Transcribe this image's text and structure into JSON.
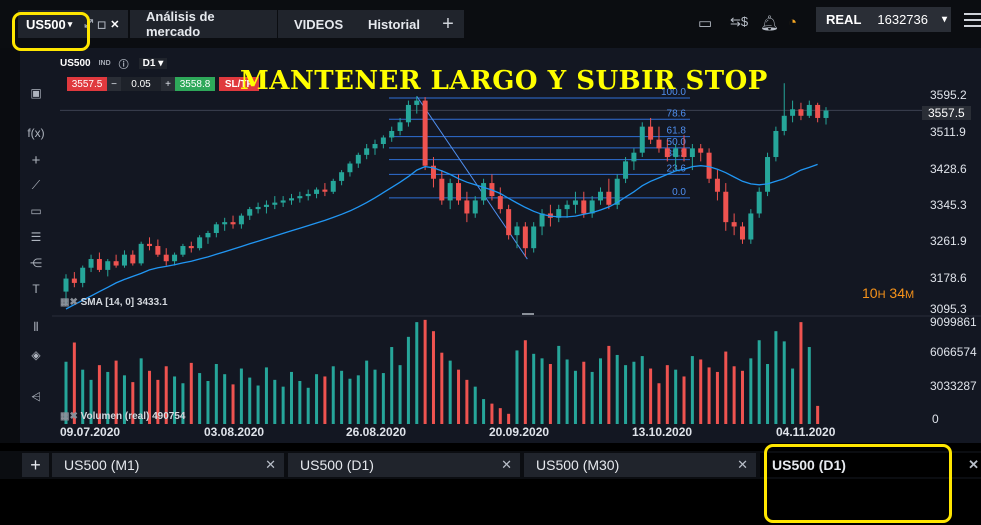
{
  "header": {
    "active_tab": {
      "symbol": "US500",
      "caret": "▾",
      "icons": [
        "expand-icon",
        "window-icon"
      ],
      "close": "✕"
    },
    "tabs": [
      {
        "label": "Análisis de mercado"
      },
      {
        "label": "VIDEOS"
      },
      {
        "label": "Historial"
      }
    ],
    "plus": "+",
    "account": {
      "label": "REAL",
      "balance": "1632736",
      "caret": "▾"
    },
    "icons": [
      "layout-icon",
      "money-icon",
      "bell-icon",
      "wifi-icon",
      "menu-icon"
    ]
  },
  "instrument": {
    "symbol": "US500",
    "type": "IND",
    "info": "ⓘ",
    "timeframe": "D1",
    "caret": "▾",
    "sell": "3557.5",
    "minus": "−",
    "volume": "0.05",
    "plus": "+",
    "buy": "3558.8",
    "sltp": "SL/TP"
  },
  "annotation": "MANTENER LARGO Y SUBIR STOP",
  "price_axis": [
    "3595.2",
    "3557.5",
    "3511.9",
    "3428.6",
    "3345.3",
    "3261.9",
    "3178.6",
    "3095.3"
  ],
  "volume_axis": [
    "9099861",
    "6066574",
    "3033287",
    "0"
  ],
  "timer": {
    "h": "10",
    "hu": "H",
    "m": "34",
    "mu": "M"
  },
  "date_labels": [
    "09.07.2020",
    "03.08.2020",
    "26.08.2020",
    "20.09.2020",
    "13.10.2020",
    "04.11.2020"
  ],
  "sma_legend": "SMA [14, 0] 3433.1",
  "volume_legend": "Volumen (real) 490754",
  "fib_levels": [
    "100.0",
    "78.6",
    "61.8",
    "50.0",
    "38.2",
    "23.6",
    "0.0"
  ],
  "bottom_tabs": [
    {
      "label": "US500 (M1)",
      "close": "✕"
    },
    {
      "label": "US500 (D1)",
      "close": "✕"
    },
    {
      "label": "US500 (M30)",
      "close": "✕"
    },
    {
      "label": "US500 (D1)",
      "close": "✕"
    }
  ],
  "bottom_plus": "+",
  "colors": {
    "up": "#26a69a",
    "down": "#ef5350",
    "sma": "#2196f3",
    "fib": "#2f6fd6",
    "highlight": "#ffe600",
    "annotation": "#ffff00"
  },
  "chart_data": {
    "type": "candlestick",
    "timeframe": "D1",
    "ylim": [
      3095.3,
      3640
    ],
    "candles": [
      [
        3140,
        3180,
        3110,
        3170
      ],
      [
        3170,
        3185,
        3150,
        3160
      ],
      [
        3160,
        3200,
        3150,
        3195
      ],
      [
        3195,
        3225,
        3185,
        3215
      ],
      [
        3215,
        3230,
        3185,
        3190
      ],
      [
        3190,
        3215,
        3175,
        3210
      ],
      [
        3210,
        3225,
        3195,
        3200
      ],
      [
        3200,
        3235,
        3195,
        3225
      ],
      [
        3225,
        3235,
        3200,
        3205
      ],
      [
        3205,
        3255,
        3200,
        3250
      ],
      [
        3250,
        3265,
        3235,
        3245
      ],
      [
        3245,
        3260,
        3220,
        3225
      ],
      [
        3225,
        3240,
        3200,
        3210
      ],
      [
        3210,
        3230,
        3200,
        3225
      ],
      [
        3225,
        3250,
        3220,
        3245
      ],
      [
        3245,
        3255,
        3230,
        3240
      ],
      [
        3240,
        3270,
        3235,
        3265
      ],
      [
        3265,
        3280,
        3250,
        3275
      ],
      [
        3275,
        3300,
        3265,
        3295
      ],
      [
        3295,
        3310,
        3280,
        3300
      ],
      [
        3300,
        3315,
        3285,
        3295
      ],
      [
        3295,
        3320,
        3285,
        3315
      ],
      [
        3315,
        3335,
        3305,
        3330
      ],
      [
        3330,
        3345,
        3320,
        3335
      ],
      [
        3335,
        3350,
        3320,
        3340
      ],
      [
        3340,
        3360,
        3330,
        3345
      ],
      [
        3345,
        3360,
        3335,
        3350
      ],
      [
        3350,
        3365,
        3340,
        3355
      ],
      [
        3355,
        3370,
        3345,
        3360
      ],
      [
        3360,
        3375,
        3350,
        3365
      ],
      [
        3365,
        3380,
        3355,
        3375
      ],
      [
        3375,
        3390,
        3360,
        3370
      ],
      [
        3370,
        3400,
        3365,
        3395
      ],
      [
        3395,
        3420,
        3385,
        3415
      ],
      [
        3415,
        3440,
        3405,
        3435
      ],
      [
        3435,
        3460,
        3425,
        3455
      ],
      [
        3455,
        3480,
        3445,
        3470
      ],
      [
        3470,
        3490,
        3455,
        3480
      ],
      [
        3480,
        3500,
        3470,
        3495
      ],
      [
        3495,
        3520,
        3485,
        3510
      ],
      [
        3510,
        3540,
        3500,
        3530
      ],
      [
        3530,
        3580,
        3520,
        3570
      ],
      [
        3570,
        3590,
        3550,
        3580
      ],
      [
        3580,
        3588,
        3420,
        3430
      ],
      [
        3430,
        3450,
        3380,
        3400
      ],
      [
        3400,
        3420,
        3340,
        3350
      ],
      [
        3350,
        3400,
        3330,
        3390
      ],
      [
        3390,
        3410,
        3340,
        3350
      ],
      [
        3350,
        3370,
        3300,
        3320
      ],
      [
        3320,
        3360,
        3310,
        3350
      ],
      [
        3350,
        3400,
        3340,
        3390
      ],
      [
        3390,
        3410,
        3350,
        3360
      ],
      [
        3360,
        3380,
        3320,
        3330
      ],
      [
        3330,
        3340,
        3260,
        3270
      ],
      [
        3270,
        3300,
        3240,
        3290
      ],
      [
        3290,
        3300,
        3220,
        3240
      ],
      [
        3240,
        3300,
        3230,
        3290
      ],
      [
        3290,
        3330,
        3270,
        3320
      ],
      [
        3320,
        3340,
        3290,
        3310
      ],
      [
        3310,
        3340,
        3300,
        3330
      ],
      [
        3330,
        3350,
        3310,
        3340
      ],
      [
        3340,
        3370,
        3320,
        3350
      ],
      [
        3350,
        3370,
        3310,
        3320
      ],
      [
        3320,
        3360,
        3310,
        3350
      ],
      [
        3350,
        3380,
        3340,
        3370
      ],
      [
        3370,
        3400,
        3330,
        3340
      ],
      [
        3340,
        3410,
        3330,
        3400
      ],
      [
        3400,
        3450,
        3390,
        3440
      ],
      [
        3440,
        3470,
        3420,
        3460
      ],
      [
        3460,
        3530,
        3450,
        3520
      ],
      [
        3520,
        3540,
        3480,
        3490
      ],
      [
        3490,
        3520,
        3460,
        3470
      ],
      [
        3470,
        3490,
        3440,
        3450
      ],
      [
        3450,
        3480,
        3420,
        3470
      ],
      [
        3470,
        3500,
        3440,
        3450
      ],
      [
        3450,
        3480,
        3420,
        3470
      ],
      [
        3470,
        3480,
        3440,
        3460
      ],
      [
        3460,
        3470,
        3390,
        3400
      ],
      [
        3400,
        3420,
        3350,
        3370
      ],
      [
        3370,
        3390,
        3280,
        3300
      ],
      [
        3300,
        3320,
        3270,
        3290
      ],
      [
        3290,
        3300,
        3250,
        3260
      ],
      [
        3260,
        3330,
        3250,
        3320
      ],
      [
        3320,
        3380,
        3310,
        3370
      ],
      [
        3370,
        3460,
        3360,
        3450
      ],
      [
        3450,
        3520,
        3440,
        3510
      ],
      [
        3510,
        3620,
        3500,
        3545
      ],
      [
        3545,
        3580,
        3530,
        3560
      ],
      [
        3560,
        3575,
        3535,
        3545
      ],
      [
        3545,
        3580,
        3540,
        3570
      ],
      [
        3570,
        3575,
        3530,
        3540
      ],
      [
        3540,
        3565,
        3525,
        3557
      ]
    ],
    "sma": [
      3100,
      3110,
      3120,
      3130,
      3140,
      3150,
      3160,
      3168,
      3175,
      3182,
      3190,
      3195,
      3198,
      3202,
      3206,
      3210,
      3215,
      3220,
      3226,
      3232,
      3238,
      3244,
      3250,
      3256,
      3262,
      3268,
      3274,
      3280,
      3286,
      3292,
      3298,
      3304,
      3311,
      3318,
      3326,
      3335,
      3345,
      3356,
      3368,
      3380,
      3392,
      3405,
      3420,
      3428,
      3425,
      3418,
      3410,
      3400,
      3392,
      3386,
      3380,
      3374,
      3366,
      3355,
      3344,
      3334,
      3325,
      3318,
      3314,
      3312,
      3312,
      3314,
      3318,
      3322,
      3328,
      3335,
      3345,
      3358,
      3370,
      3384,
      3394,
      3402,
      3410,
      3418,
      3422,
      3428,
      3430,
      3428,
      3422,
      3414,
      3404,
      3394,
      3388,
      3386,
      3388,
      3394,
      3400,
      3410,
      3420,
      3426,
      3433
    ],
    "volume": [
      5500000,
      7200000,
      4800000,
      3900000,
      5200000,
      4600000,
      5600000,
      4300000,
      3700000,
      5800000,
      4700000,
      3900000,
      5100000,
      4200000,
      3600000,
      5400000,
      4500000,
      3800000,
      5300000,
      4400000,
      3500000,
      4900000,
      4100000,
      3400000,
      5000000,
      3900000,
      3300000,
      4600000,
      3800000,
      3200000,
      4400000,
      4200000,
      5100000,
      4700000,
      4000000,
      4300000,
      5600000,
      4800000,
      4500000,
      6800000,
      5200000,
      7700000,
      9000000,
      9200000,
      8200000,
      6300000,
      5600000,
      4800000,
      3900000,
      3300000,
      2200000,
      1800000,
      1400000,
      900000,
      6500000,
      7400000,
      6200000,
      5800000,
      5300000,
      6900000,
      5700000,
      4700000,
      5500000,
      4600000,
      5800000,
      6900000,
      6100000,
      5200000,
      5500000,
      6000000,
      4900000,
      3600000,
      5200000,
      4800000,
      4200000,
      6000000,
      5700000,
      5000000,
      4600000,
      6400000,
      5100000,
      4700000,
      5800000,
      7400000,
      5300000,
      8200000,
      7300000,
      4900000,
      9000000,
      6800000,
      1600000
    ],
    "volume_ylim": [
      0,
      9099861
    ],
    "fib": [
      {
        "level": "100.0",
        "price": 3586
      },
      {
        "level": "78.6",
        "price": 3537
      },
      {
        "level": "61.8",
        "price": 3497
      },
      {
        "level": "50.0",
        "price": 3471
      },
      {
        "level": "38.2",
        "price": 3444
      },
      {
        "level": "23.6",
        "price": 3410
      },
      {
        "level": "0.0",
        "price": 3356
      }
    ],
    "xticks": [
      "09.07.2020",
      "03.08.2020",
      "26.08.2020",
      "20.09.2020",
      "13.10.2020",
      "04.11.2020"
    ]
  }
}
